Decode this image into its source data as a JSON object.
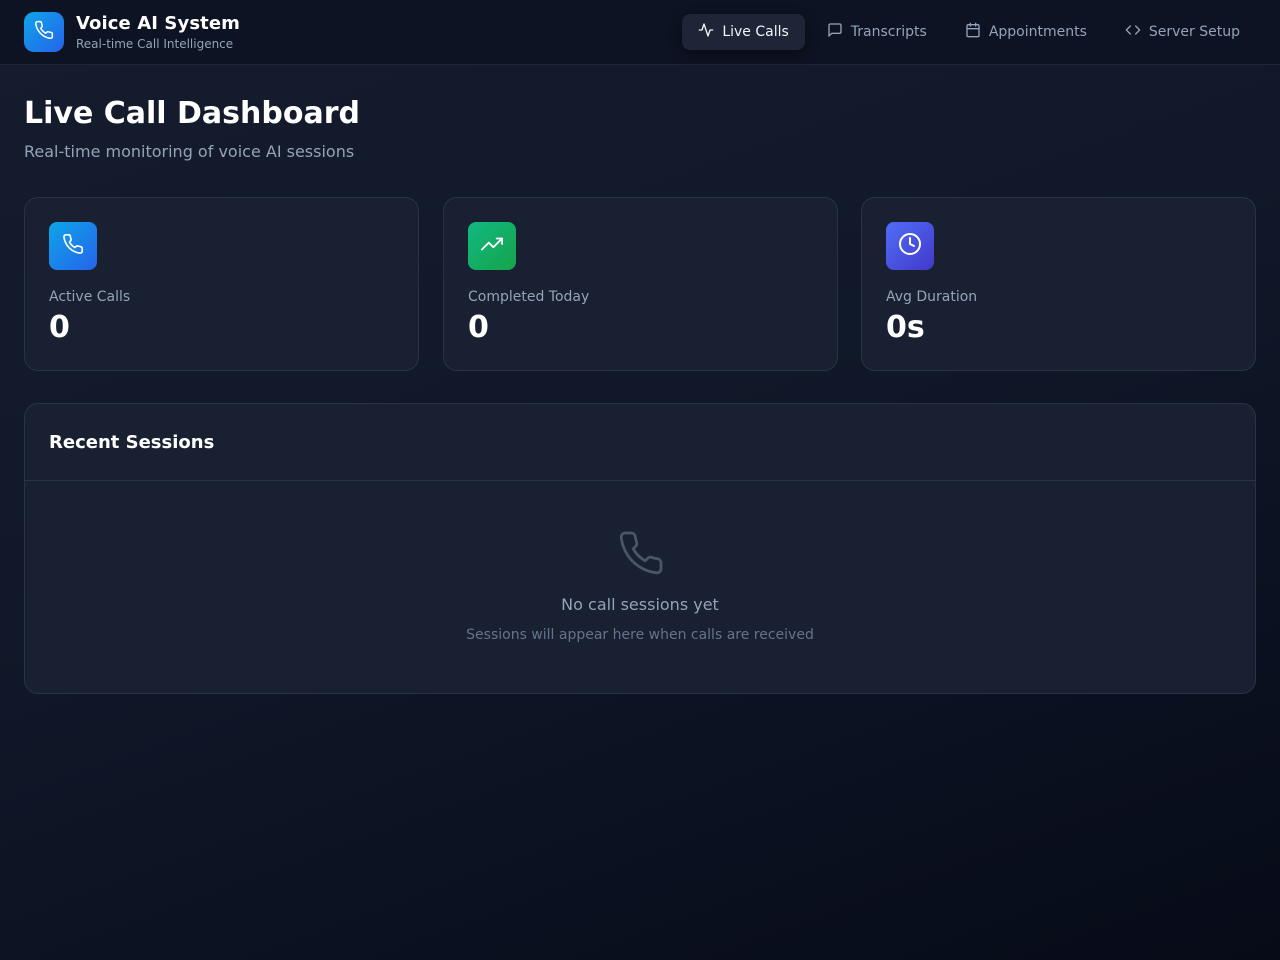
{
  "app": {
    "title": "Voice AI System",
    "subtitle": "Real-time Call Intelligence",
    "logo_icon": "phone-icon",
    "accent": "#0ea5e9"
  },
  "nav": {
    "items": [
      {
        "label": "Live Calls",
        "icon": "activity-icon",
        "active": true
      },
      {
        "label": "Transcripts",
        "icon": "message-square-icon",
        "active": false
      },
      {
        "label": "Appointments",
        "icon": "calendar-icon",
        "active": false
      },
      {
        "label": "Server Setup",
        "icon": "code-icon",
        "active": false
      }
    ]
  },
  "page": {
    "title": "Live Call Dashboard",
    "subtitle": "Real-time monitoring of voice AI sessions"
  },
  "stats": [
    {
      "label": "Active Calls",
      "value": "0",
      "icon": "phone-icon",
      "color": "#0ea5e9"
    },
    {
      "label": "Completed Today",
      "value": "0",
      "icon": "trending-up-icon",
      "color": "#10b981"
    },
    {
      "label": "Avg Duration",
      "value": "0s",
      "icon": "clock-icon",
      "color": "#4f6ef7"
    }
  ],
  "sessions": {
    "title": "Recent Sessions",
    "empty_icon": "phone-icon",
    "empty_title": "No call sessions yet",
    "empty_subtitle": "Sessions will appear here when calls are received"
  }
}
